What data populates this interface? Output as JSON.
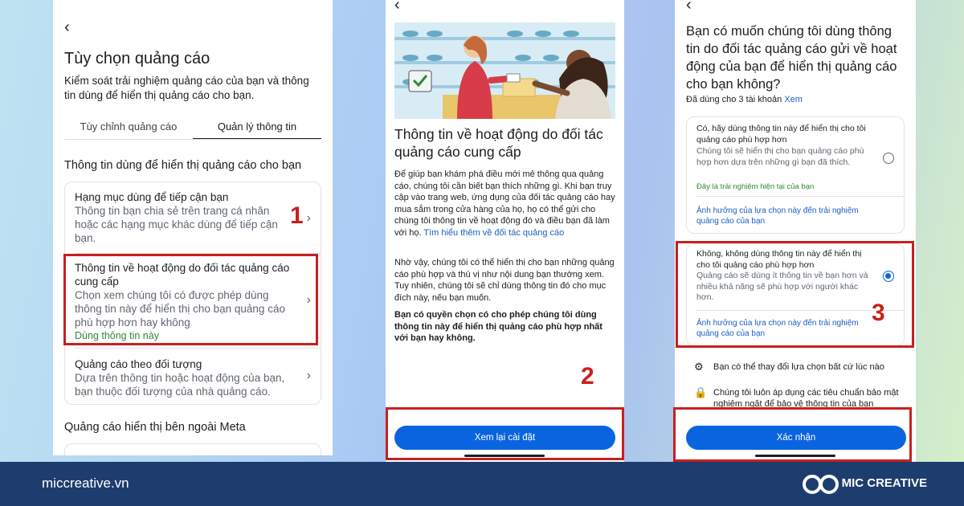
{
  "panel1": {
    "back_glyph": "‹",
    "title": "Tùy chọn quảng cáo",
    "description": "Kiểm soát trải nghiệm quảng cáo của bạn và thông tin dùng để hiển thị quảng cáo cho bạn.",
    "tabs": [
      "Tùy chỉnh quảng cáo",
      "Quản lý thông tin"
    ],
    "section_title": "Thông tin dùng để hiển thị quảng cáo cho bạn",
    "rows": [
      {
        "title": "Hạng mục dùng để tiếp cận bạn",
        "desc": "Thông tin bạn chia sẻ trên trang cá nhân hoặc các hạng mục khác dùng để tiếp cận bạn.",
        "status": ""
      },
      {
        "title": "Thông tin về hoạt động do đối tác quảng cáo cung cấp",
        "desc": "Chọn xem chúng tôi có được phép dùng thông tin này để hiển thị cho bạn quảng cáo phù hợp hơn hay không",
        "status": "Dùng thông tin này"
      },
      {
        "title": "Quảng cáo theo đối tượng",
        "desc": "Dựa trên thông tin hoặc hoạt động của bạn, bạn thuộc đối tượng của nhà quảng cáo.",
        "status": ""
      }
    ],
    "section2_title": "Quảng cáo hiển thị bên ngoài Meta",
    "step_number": "1"
  },
  "panel2": {
    "back_glyph": "‹",
    "heading": "Thông tin về hoạt động do đối tác quảng cáo cung cấp",
    "para1": "Để giúp bạn khám phá điều mới mẻ thông qua quảng cáo, chúng tôi cần biết bạn thích những gì. Khi bạn truy cập vào trang web, ứng dụng của đối tác quảng cáo hay mua sắm trong cửa hàng của họ, họ có thể gửi cho chúng tôi thông tin về hoạt động đó và điều bạn đã làm với họ. ",
    "para1_link": "Tìm hiểu thêm về đối tác quảng cáo",
    "para2": "Nhờ vậy, chúng tôi có thể hiển thị cho bạn những quảng cáo phù hợp và thú vị như nội dung bạn thường xem. Tuy nhiên, chúng tôi sẽ chỉ dùng thông tin đó cho mục đích này, nếu bạn muốn.",
    "para3": "Bạn có quyền chọn có cho phép chúng tôi dùng thông tin này để hiển thị quảng cáo phù hợp nhất với bạn hay không.",
    "button": "Xem lại cài đặt",
    "step_number": "2"
  },
  "panel3": {
    "back_glyph": "‹",
    "heading": "Bạn có muốn chúng tôi dùng thông tin do đối tác quảng cáo gửi về hoạt động của bạn để hiển thị quảng cáo cho bạn không?",
    "subtitle": "Đã dùng cho 3 tài khoản ",
    "subtitle_link": "Xem",
    "options": [
      {
        "title": "Có, hãy dùng thông tin này để hiển thị cho tôi quảng cáo phù hợp hơn",
        "desc": "Chúng tôi sẽ hiển thị cho bạn quảng cáo phù hợp hơn dựa trên những gì bạn đã thích.",
        "status": "Đây là trải nghiệm hiện tại của bạn",
        "link": "Ảnh hưởng của lựa chọn này đến trải nghiệm quảng cáo của bạn",
        "selected": false
      },
      {
        "title": "Không, không dùng thông tin này để hiển thị cho tôi quảng cáo phù hợp hơn",
        "desc": "Quảng cáo sẽ dùng ít thông tin về bạn hơn và nhiều khả năng sẽ phù hợp với người khác hơn.",
        "status": "",
        "link": "Ảnh hưởng của lựa chọn này đến trải nghiệm quảng cáo của bạn",
        "selected": true
      }
    ],
    "note1": "Bạn có thể thay đổi lựa chọn bất cứ lúc nào",
    "note2": "Chúng tôi luôn áp dụng các tiêu chuẩn bảo mật nghiêm ngặt để bảo vệ thông tin của bạn",
    "button": "Xác nhận",
    "step_number": "3"
  },
  "footer": {
    "url": "miccreative.vn",
    "brand": "MIC CREATIVE"
  },
  "colors": {
    "accent": "#0a64e0",
    "highlight": "#c8201f",
    "footer_bg": "#1d3d6e",
    "status_green": "#2e8b34"
  }
}
